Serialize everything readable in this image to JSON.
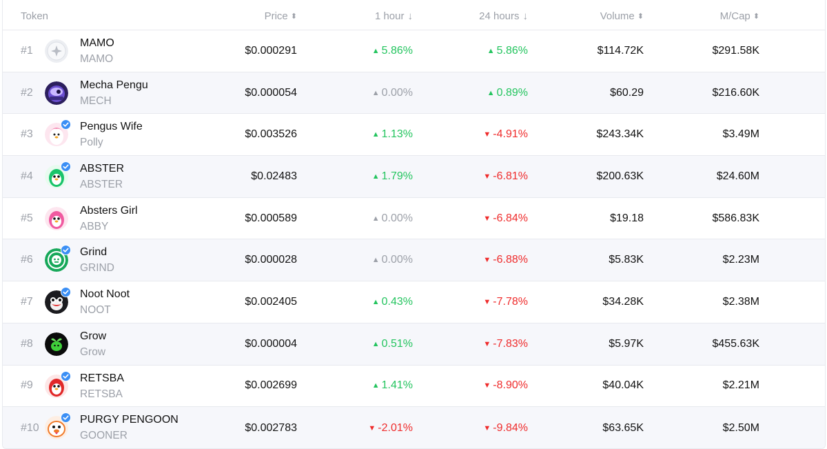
{
  "header": {
    "token": "Token",
    "price": "Price",
    "hour1": "1 hour",
    "hours24": "24 hours",
    "volume": "Volume",
    "mcap": "M/Cap",
    "sort_icon": "⬍",
    "desc_icon": "↓"
  },
  "colors": {
    "up": "#23c45e",
    "down": "#ef2b2b",
    "flat": "#9ca0a8",
    "verified": "#3b8ff5"
  },
  "rows": [
    {
      "rank": "#1",
      "name": "MAMO",
      "symbol": "MAMO",
      "price": "$0.000291",
      "h1": "5.86%",
      "h1_dir": "up",
      "h24": "5.86%",
      "h24_dir": "up",
      "volume": "$114.72K",
      "mcap": "$291.58K",
      "verified": false,
      "avatar": "mamo-logo-icon"
    },
    {
      "rank": "#2",
      "name": "Mecha Pengu",
      "symbol": "MECH",
      "price": "$0.000054",
      "h1": "0.00%",
      "h1_dir": "flat",
      "h24": "0.89%",
      "h24_dir": "up",
      "volume": "$60.29",
      "mcap": "$216.60K",
      "verified": false,
      "avatar": "mecha-pengu-icon"
    },
    {
      "rank": "#3",
      "name": "Pengus Wife",
      "symbol": "Polly",
      "price": "$0.003526",
      "h1": "1.13%",
      "h1_dir": "up",
      "h24": "-4.91%",
      "h24_dir": "down",
      "volume": "$243.34K",
      "mcap": "$3.49M",
      "verified": true,
      "avatar": "pengus-wife-icon"
    },
    {
      "rank": "#4",
      "name": "ABSTER",
      "symbol": "ABSTER",
      "price": "$0.02483",
      "h1": "1.79%",
      "h1_dir": "up",
      "h24": "-6.81%",
      "h24_dir": "down",
      "volume": "$200.63K",
      "mcap": "$24.60M",
      "verified": true,
      "avatar": "abster-icon"
    },
    {
      "rank": "#5",
      "name": "Absters Girl",
      "symbol": "ABBY",
      "price": "$0.000589",
      "h1": "0.00%",
      "h1_dir": "flat",
      "h24": "-6.84%",
      "h24_dir": "down",
      "volume": "$19.18",
      "mcap": "$586.83K",
      "verified": false,
      "avatar": "absters-girl-icon"
    },
    {
      "rank": "#6",
      "name": "Grind",
      "symbol": "GRIND",
      "price": "$0.000028",
      "h1": "0.00%",
      "h1_dir": "flat",
      "h24": "-6.88%",
      "h24_dir": "down",
      "volume": "$5.83K",
      "mcap": "$2.23M",
      "verified": true,
      "avatar": "grind-icon"
    },
    {
      "rank": "#7",
      "name": "Noot Noot",
      "symbol": "NOOT",
      "price": "$0.002405",
      "h1": "0.43%",
      "h1_dir": "up",
      "h24": "-7.78%",
      "h24_dir": "down",
      "volume": "$34.28K",
      "mcap": "$2.38M",
      "verified": true,
      "avatar": "noot-noot-icon"
    },
    {
      "rank": "#8",
      "name": "Grow",
      "symbol": "Grow",
      "price": "$0.000004",
      "h1": "0.51%",
      "h1_dir": "up",
      "h24": "-7.83%",
      "h24_dir": "down",
      "volume": "$5.97K",
      "mcap": "$455.63K",
      "verified": false,
      "avatar": "grow-icon"
    },
    {
      "rank": "#9",
      "name": "RETSBA",
      "symbol": "RETSBA",
      "price": "$0.002699",
      "h1": "1.41%",
      "h1_dir": "up",
      "h24": "-8.90%",
      "h24_dir": "down",
      "volume": "$40.04K",
      "mcap": "$2.21M",
      "verified": true,
      "avatar": "retsba-icon"
    },
    {
      "rank": "#10",
      "name": "PURGY PENGOON",
      "symbol": "GOONER",
      "price": "$0.002783",
      "h1": "-2.01%",
      "h1_dir": "down",
      "h24": "-9.84%",
      "h24_dir": "down",
      "volume": "$63.65K",
      "mcap": "$2.50M",
      "verified": true,
      "avatar": "purgy-pengoon-icon"
    }
  ]
}
